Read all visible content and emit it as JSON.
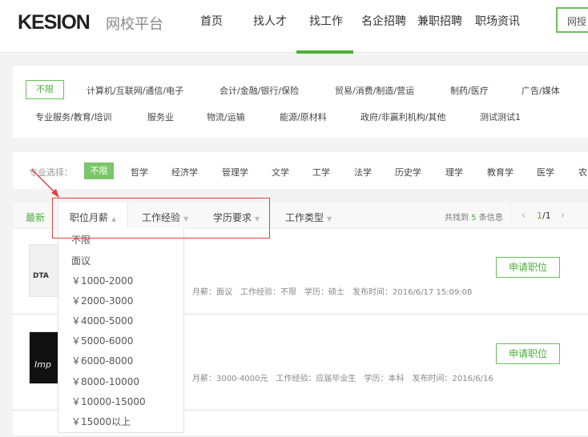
{
  "header": {
    "logo": "KESION",
    "logo_sub": "网校平台",
    "nav": [
      "首页",
      "找人才",
      "找工作",
      "名企招聘",
      "兼职招聘",
      "职场资讯"
    ],
    "active_nav": "找工作",
    "right_button": "网授"
  },
  "industries": [
    "不限",
    "计算机/互联网/通信/电子",
    "会计/金融/银行/保险",
    "贸易/消费/制造/营运",
    "制药/医疗",
    "广告/媒体",
    "专业服务/教育/培训",
    "服务业",
    "物流/运输",
    "能源/原材料",
    "政府/非赢利机构/其他",
    "测试测试1"
  ],
  "majors": {
    "label": "专业选择：",
    "items": [
      "不限",
      "哲学",
      "经济学",
      "管理学",
      "文学",
      "工学",
      "法学",
      "历史学",
      "理学",
      "教育学",
      "医学",
      "农"
    ]
  },
  "tabs": {
    "latest": "最新",
    "salary": "职位月薪",
    "experience": "工作经验",
    "education": "学历要求",
    "type": "工作类型"
  },
  "count": {
    "prefix": "共找到",
    "num": "5",
    "suffix": "条信息"
  },
  "pager": {
    "current": "1",
    "total": "/1"
  },
  "salary_options": [
    "不限",
    "面议",
    "￥1000-2000",
    "￥2000-3000",
    "￥4000-5000",
    "￥5000-6000",
    "￥6000-8000",
    "￥8000-10000",
    "￥10000-15000",
    "￥15000以上"
  ],
  "jobs": [
    {
      "meta": "月薪：面议　工作经验：不限　学历：硕士　发布时间：2016/6/17 15:09:08",
      "apply": "申请职位",
      "logo_text": "DTA"
    },
    {
      "meta": "月薪：3000-4000元　工作经验：应届毕业生　学历：本科　发布时间：2016/6/16",
      "apply": "申请职位",
      "logo_text": "Imp"
    }
  ],
  "colors": {
    "accent": "#4caf37",
    "annotation": "#e04040"
  }
}
